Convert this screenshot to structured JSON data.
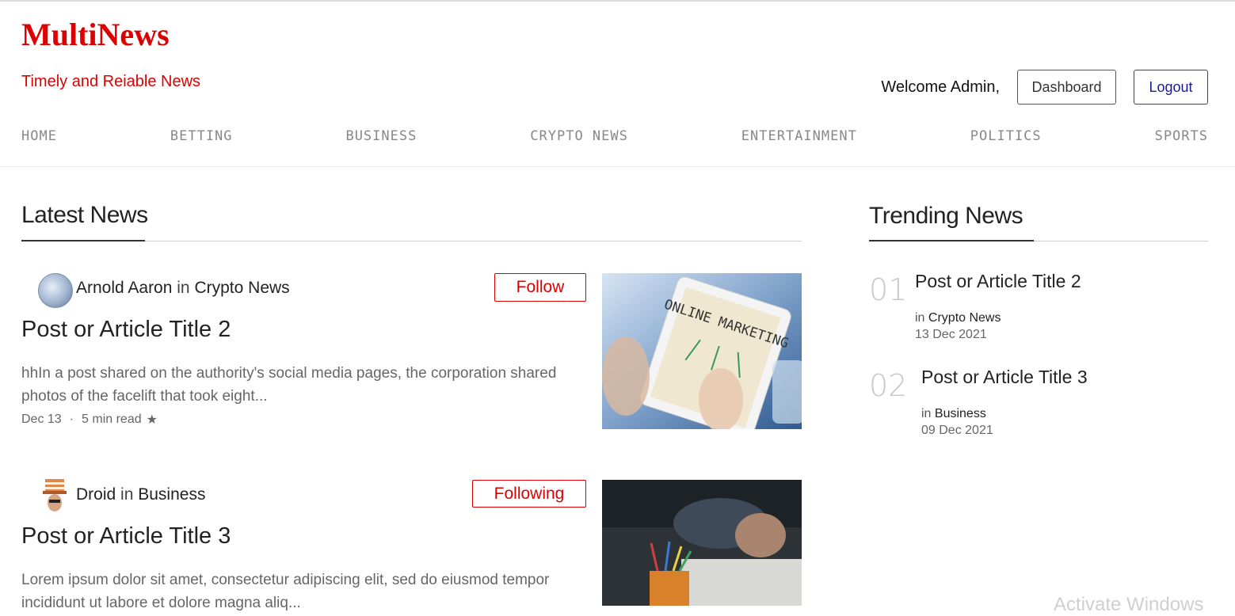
{
  "header": {
    "logo": "MultiNews",
    "tagline": "Timely and Reiable News",
    "welcome": "Welcome Admin,",
    "dashboard_label": "Dashboard",
    "logout_label": "Logout"
  },
  "nav": [
    "HOME",
    "BETTING",
    "BUSINESS",
    "CRYPTO NEWS",
    "ENTERTAINMENT",
    "POLITICS",
    "SPORTS"
  ],
  "latest": {
    "heading": "Latest News",
    "posts": [
      {
        "author": "Arnold Aaron",
        "in": "in",
        "category": "Crypto News",
        "follow_label": "Follow",
        "title": "Post or Article Title 2",
        "excerpt": "hhIn a post shared on the authority's social media pages, the corporation shared photos of the facelift that took eight...",
        "date": "Dec 13",
        "dot": "·",
        "read_time": "5 min read",
        "star": "★",
        "image_text": "ONLINE MARKETING"
      },
      {
        "author": "Droid",
        "in": "in",
        "category": "Business",
        "follow_label": "Following",
        "title": "Post or Article Title 3",
        "excerpt": "Lorem ipsum dolor sit amet, consectetur adipiscing elit, sed do eiusmod tempor incididunt ut labore et dolore magna aliq..."
      }
    ]
  },
  "trending": {
    "heading": "Trending News",
    "items": [
      {
        "num": "01",
        "title": "Post or Article Title 2",
        "in": "in",
        "category": "Crypto News",
        "date": "13 Dec 2021"
      },
      {
        "num": "02",
        "title": "Post or Article Title 3",
        "in": "in",
        "category": "Business",
        "date": "09 Dec 2021"
      }
    ]
  },
  "watermark": "Activate Windows",
  "colors": {
    "brand": "#dd0000",
    "nav_text": "#888888",
    "logout_text": "#1a1a8c"
  }
}
